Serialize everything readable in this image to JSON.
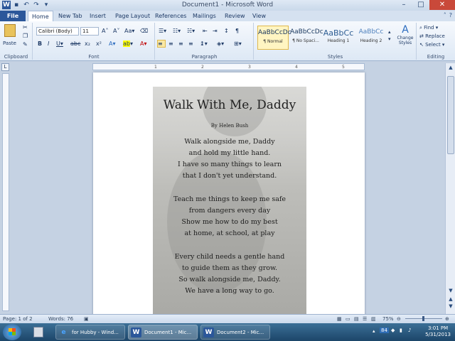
{
  "window": {
    "title": "Document1 - Microsoft Word"
  },
  "ribbon_tabs": [
    "File",
    "Home",
    "New Tab",
    "Insert",
    "Page Layout",
    "References",
    "Mailings",
    "Review",
    "View"
  ],
  "clipboard": {
    "paste_label": "Paste",
    "group_label": "Clipboard"
  },
  "font": {
    "name": "Calibri (Body)",
    "size": "11",
    "group_label": "Font"
  },
  "paragraph": {
    "group_label": "Paragraph"
  },
  "styles": {
    "group_label": "Styles",
    "items": [
      {
        "preview": "AaBbCcDc",
        "name": "¶ Normal"
      },
      {
        "preview": "AaBbCcDc",
        "name": "¶ No Spaci..."
      },
      {
        "preview": "AaBbCc",
        "name": "Heading 1"
      },
      {
        "preview": "AaBbCc",
        "name": "Heading 2"
      }
    ],
    "change_styles": "Change Styles"
  },
  "editing": {
    "find": "Find",
    "replace": "Replace",
    "select": "Select",
    "group_label": "Editing"
  },
  "poem": {
    "title": "Walk With Me, Daddy",
    "author": "By Helen Bush",
    "stanzas": [
      [
        "Walk alongside me, Daddy",
        "and hold my little hand.",
        "I have so many things to learn",
        "that I don't yet understand."
      ],
      [
        "Teach me things to keep me safe",
        "from dangers every day",
        "Show me how to do my best",
        "at home, at school, at play"
      ],
      [
        "Every child needs a gentle hand",
        "to guide them as they grow.",
        "So walk alongside me, Daddy.",
        "We have a long way to go."
      ]
    ]
  },
  "status": {
    "page": "Page: 1 of 2",
    "words": "Words: 76",
    "zoom": "75%"
  },
  "taskbar": {
    "items": [
      "for Hubby - Wind...",
      "Document1 - Mic...",
      "Document2 - Mic..."
    ],
    "tray_badge": "84",
    "time": "3:01 PM",
    "date": "5/31/2013"
  }
}
